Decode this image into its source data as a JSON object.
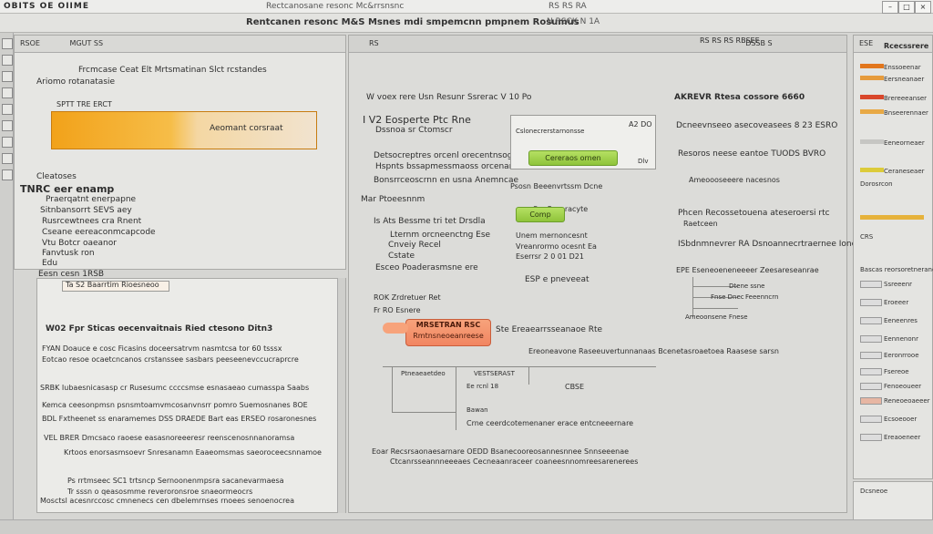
{
  "title_bar": {
    "app_name": "OBITS OE OIIME",
    "document_title": "Rectcanosane resonc Mc&rrsnsnc",
    "tab_text": "RS RS RA"
  },
  "menubar": {
    "center_text": "Rentcanen resonc M&S Msnes mdi smpemcnn pmpnem Rosumus",
    "right_text": "N RSCK N 1A"
  },
  "left_panel": {
    "header": "RSOE",
    "toolbar_text": "MGUT SS",
    "title": "Frcmcase Ceat Elt Mrtsmatinan Slct rcstandes",
    "subtitle": "Ariomo rotanatasie",
    "orange_label": "Aeomant corsraat",
    "section_label": "Cleatoses",
    "tree": [
      "TNRC eer enamp",
      "Praerqatnt enerpapne",
      "Sitnbansorrt SEVS aey",
      "Rusrcewtnees cra Rnent",
      "Cseane eereaconmcapcode",
      "Vtu Botcr oaeanor",
      "Fanvtusk ron",
      "Edu"
    ],
    "breadcrumb": "Eesn cesn 1RSB"
  },
  "left_lower": {
    "input_label": "Ta S2 Baarrtim Rioesneoo",
    "heading": "W02 Fpr Sticas oecenvaitnais Ried ctesono Ditn3",
    "lines": [
      "FYAN  Doauce e cosc Ficasins doceersatrvm nasmtcsa tor 60 tsssx",
      "Eotcao resoe ocaetcncanos crstanssee sasbars peeseenevccucraprcre",
      "SRBK  Iubaesnicasasp cr Rusesumc ccccsmse esnasaeao cumasspa Saabs",
      "Kemca ceesonpmsn psnsmtoamvmcosanvnsrr pomro Suemosnanes 8OE",
      "BDL Fxtheenet ss enaramemes DSS DRAEDE  Bart eas ERSEO rosaronesnes",
      "VEL BRER  Dmcsaco raoese easasnoreeeresr reenscenosnnanoramsa",
      "Krtoos enorsasmsoevr Snresanamn Eaaeomsmas saeoroceecsnnamoe",
      "Ps rrtmseec SC1 trtsncp Sernoonenmpsra sacanevarmaesa",
      "Tr sssn o qeasosmme reveroronsroe snaeormeocrs",
      "Mosctsl acesnrccosc cmnenecs cen dbelemrnses rnoees senoenocrea"
    ]
  },
  "center_panel": {
    "header_tab": "DSSB S",
    "ctrl_badge": "RS",
    "top_line": "W voex rere Usn Resunr Ssrerac V 10 Po",
    "heading": "I V2 Eosperte Ptc Rne",
    "sub_heading": "Dssnoa sr Ctomscr",
    "desc_lines": [
      "Detsocreptres orcenl orecentnsoge",
      "Hspnts bssapmessmaoss orcenanom tue"
    ],
    "mini_box_label": "Cslonecrerstarnonsse",
    "mini_box_code": "A2 DO",
    "green1": "Cereraos ornen",
    "green2": "Comp",
    "mini_side": "Dlv",
    "row_a": "Bonsrrceoscrnn en usna Anemncae",
    "row_b": "Psosn Beeenvrtssm Dcne",
    "row_c": "Mar Ptoeesnnm",
    "row_d": "Ser Fcenracyte",
    "list": [
      "Is Ats Bessme tri tet Drsdla",
      "Lternm orcneenctng Ese",
      "Cnveiy Recel",
      "Cstate"
    ],
    "right_list": [
      "Unem mernoncesnt",
      "Vreanrormo ocesnt Ea",
      "Eserrsr 2 0 01 D21"
    ],
    "mid_label": "Esceo Poaderasmsne ere",
    "esp": "ESP e pneveeat",
    "rto": "ROK Zrdretuer Ret",
    "r4": "Fr RO Esnere",
    "salmon_line1": "MRSETRAN RSC",
    "salmon_line2": "Rmtnsneoeanreese",
    "beside_salmon": "Ste Ereaearrsseanaoe Rte",
    "flow_top": "Ereoneavone Raseeuvertunnanaas Bcenetasroaetoea Raasese sarsn",
    "flow_nodes": [
      "Ptneaeaetdeo",
      "VESTSERAST",
      "CBSE",
      "Ee rcnl 18"
    ],
    "flow_bottom1": "Bawan",
    "flow_bottom2": "Crne ceerdcotemenaner erace entcneeernare",
    "footer1": "Eoar  Recsrsaonaesarnare OEDD Bsanecooreosannesnnee Snnseeenae",
    "footer2": "Ctcanrsseannneeeaes Cecneaanraceer coaneesnnomreesarenerees"
  },
  "right_panel": {
    "header": "RS RS RS RBSEE",
    "title": "AKREVR Rtesa cossore 6660",
    "sub": "Dcneevnseeo asecoveasees 8 23 ESRO",
    "row1": "Resoros neese eantoe TUODS BVRO",
    "row2": "Ameoooseeere nacesnos",
    "row3": "Phcen Recossetouena ateseroersi rtc",
    "row4": "Raetceen",
    "row5": "ISbdnmnevrer RA Dsnoannecrtraernee Ioneeeee",
    "diagram_label": "EPE Eseneoeneneeeer Zeesareseanrae",
    "diagram_items": [
      "Dtene ssne",
      "Fnse Dnec",
      "Feeenncrn",
      "Ameoonsene Fnese"
    ]
  },
  "far_right": {
    "header": "ESE",
    "title": "Rcecssrere",
    "items": [
      "Enssoeenar",
      "Eersneanaer",
      "Brereeeanser",
      "Bnseerennaer",
      "Eeneorneaer",
      "Ceraneseaer"
    ],
    "mid_label": "Dorosrcon",
    "sub_header": "CRS",
    "rows": [
      "Bascas reorsoretnerane",
      "Ssreeenr",
      "Eroeeer",
      "Eeneenres",
      "Eennenonr",
      "Eeronrrooe",
      "Fsereoe",
      "Fenoeoueer",
      "Reneoeoaeeer",
      "Ecsoeooer",
      "Ereaoeneer"
    ],
    "bottom": "Dcsneoe"
  },
  "colors": {
    "orange": "#f2a21a",
    "green": "#8fc43a",
    "salmon": "#f18561",
    "panel": "#e6e6e3"
  }
}
